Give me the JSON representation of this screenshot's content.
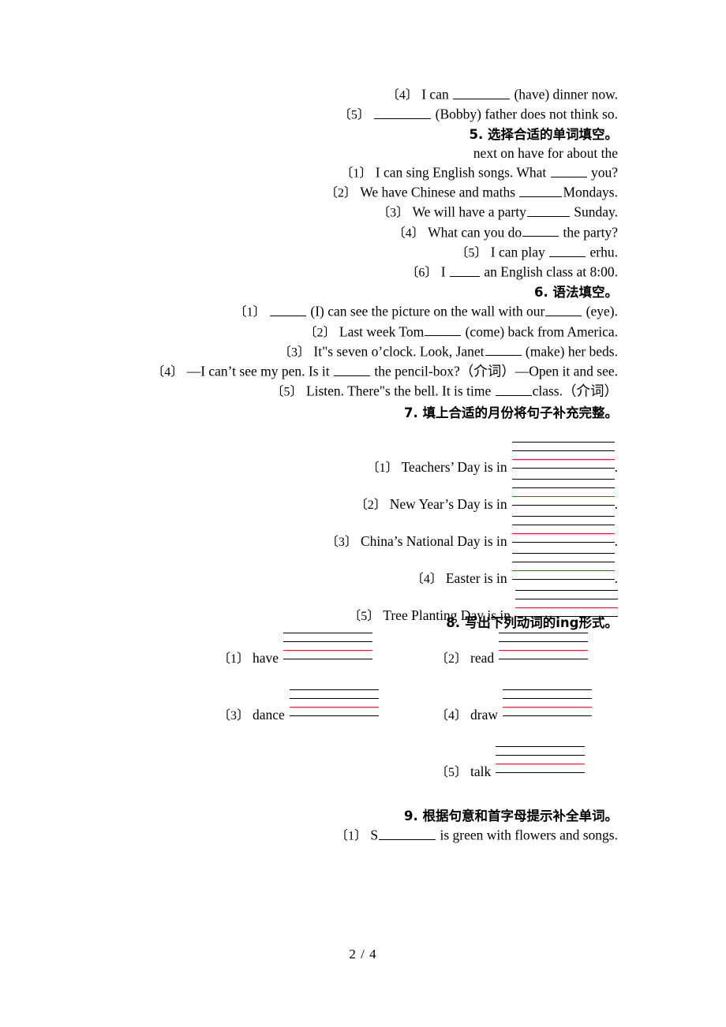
{
  "page": {
    "footer_label": "2 / 4"
  },
  "colors": {
    "text": "#000000",
    "rule_black": "#000000",
    "rule_red": "#ee1b1b",
    "background": "#ffffff"
  },
  "carryover_items": [
    {
      "num": "〔4〕",
      "before": "I can ",
      "blank": "b8",
      "after": " (have) dinner now."
    },
    {
      "num": "〔5〕",
      "before": "",
      "blank": "b8",
      "after": " (Bobby) father does not think so."
    }
  ],
  "sections": [
    {
      "id": "section-5",
      "number": "5.",
      "title_cn": "选择合适的单词填空。",
      "wordbank": "next   on have for about the",
      "items": [
        {
          "num": "〔1〕",
          "before": "I can sing English songs. What ",
          "blank": "b5",
          "after": " you?"
        },
        {
          "num": "〔2〕",
          "before": "We have Chinese and maths ",
          "blank": "b6",
          "after": "Mondays."
        },
        {
          "num": "〔3〕",
          "before": "We will have a party",
          "blank": "b6",
          "after": " Sunday."
        },
        {
          "num": "〔4〕",
          "before": "What can you do",
          "blank": "b5",
          "after": " the party?"
        },
        {
          "num": "〔5〕",
          "before": "I can play ",
          "blank": "b5",
          "after": " erhu."
        },
        {
          "num": "〔6〕",
          "before": "I ",
          "blank": "b4",
          "after": " an English class at 8:00."
        }
      ]
    },
    {
      "id": "section-6",
      "number": "6.",
      "title_cn": "语法填空。",
      "items": [
        {
          "num": "〔1〕",
          "before": " ",
          "blank": "b5",
          "after": " (I) can see the picture on the wall with our",
          "blank2": "b5",
          "after2": " (eye)."
        },
        {
          "num": "〔2〕",
          "before": "Last week Tom",
          "blank": "b5",
          "after": " (come) back from America."
        },
        {
          "num": "〔3〕",
          "before": "It\"s seven o’clock. Look, Janet",
          "blank": "b5",
          "after": " (make) her beds."
        },
        {
          "num": "〔4〕",
          "before": "—I can’t see my pen. Is it ",
          "blank": "b5",
          "after": " the pencil-box?（介词）—Open it and see."
        },
        {
          "num": "〔5〕",
          "before": "Listen. There\"s the bell. It is time ",
          "blank": "b5",
          "after": "class.（介词）"
        }
      ]
    },
    {
      "id": "section-7",
      "number": "7.",
      "title_cn": "填上合适的月份将句子补充完整。",
      "items": [
        {
          "num": "〔1〕",
          "prompt": "Teachers’ Day is in",
          "tail": "."
        },
        {
          "num": "〔2〕",
          "prompt": "New Year’s Day is in",
          "tail": "."
        },
        {
          "num": "〔3〕",
          "prompt": "China’s National Day is in",
          "tail": "."
        },
        {
          "num": "〔4〕",
          "prompt": "Easter is in",
          "tail": "."
        },
        {
          "num": "〔5〕",
          "prompt": "Tree Planting Day is in",
          "tail": ""
        }
      ]
    },
    {
      "id": "section-8",
      "number": "8.",
      "title_cn": "写出下列动词的ing形式。",
      "title_bold_en": "ing",
      "items": [
        {
          "num": "〔1〕",
          "word": "have"
        },
        {
          "num": "〔2〕",
          "word": "read"
        },
        {
          "num": "〔3〕",
          "word": "dance"
        },
        {
          "num": "〔4〕",
          "word": "draw"
        },
        {
          "num": "〔5〕",
          "word": "talk"
        }
      ]
    },
    {
      "id": "section-9",
      "number": "9.",
      "title_cn": "根据句意和首字母提示补全单词。",
      "items": [
        {
          "num": "〔1〕",
          "before": "S",
          "blank": "b8",
          "after": " is green with flowers and songs."
        }
      ]
    }
  ]
}
